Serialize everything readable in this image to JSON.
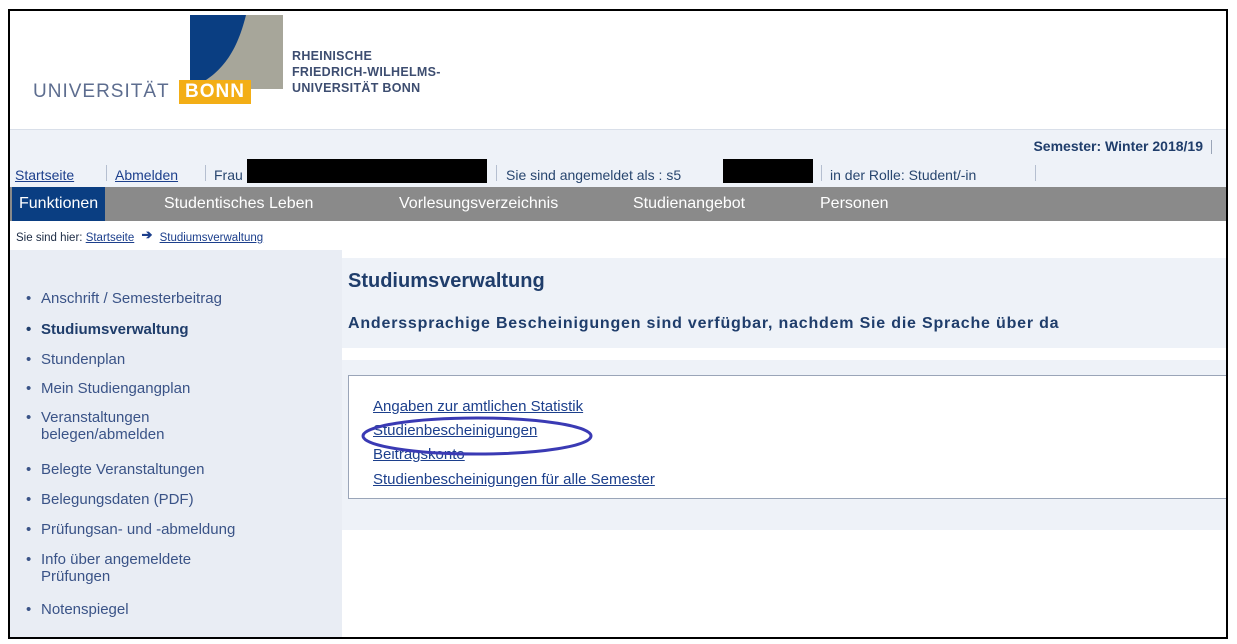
{
  "header": {
    "logo_word": "UNIVERSITÄT",
    "logo_bonn": "BONN",
    "logo_fullname": [
      "RHEINISCHE",
      "FRIEDRICH-WILHELMS-",
      "UNIVERSITÄT BONN"
    ],
    "colors": {
      "logo_blue": "#0a3e82",
      "logo_grey": "#a7a69a",
      "logo_orange": "#f3ae16"
    }
  },
  "semester": "Semester: Winter 2018/19",
  "user_bar": {
    "startseite": "Startseite",
    "abmelden": "Abmelden",
    "name_prefix": "Frau",
    "logged_in_as": "Sie sind angemeldet als : s5",
    "role": "in der Rolle: Student/-in"
  },
  "menu": [
    "Funktionen",
    "Studentisches Leben",
    "Vorlesungsverzeichnis",
    "Studienangebot",
    "Personen"
  ],
  "breadcrumb": {
    "prefix": "Sie sind hier:",
    "items": [
      "Startseite",
      "Studiumsverwaltung"
    ]
  },
  "sidebar": {
    "items": [
      "Anschrift / Semesterbeitrag",
      "Studiumsverwaltung",
      "Stundenplan",
      "Mein Studiengangplan",
      "Veranstaltungen belegen/abmelden",
      "Belegte Veranstaltungen",
      "Belegungsdaten (PDF)",
      "Prüfungsan- und -abmeldung",
      "Info über angemeldete Prüfungen",
      "Notenspiegel"
    ],
    "active_index": 1
  },
  "main": {
    "title": "Studiumsverwaltung",
    "subtitle": "Anderssprachige Bescheinigungen sind verfügbar, nachdem Sie die Sprache über da",
    "links": [
      "Angaben zur amtlichen Statistik",
      "Studienbescheinigungen",
      "Beitragskonto",
      "Studienbescheinigungen für alle Semester"
    ],
    "highlighted_link_index": 1,
    "colors": {
      "highlight": "#3a3ab4"
    }
  }
}
